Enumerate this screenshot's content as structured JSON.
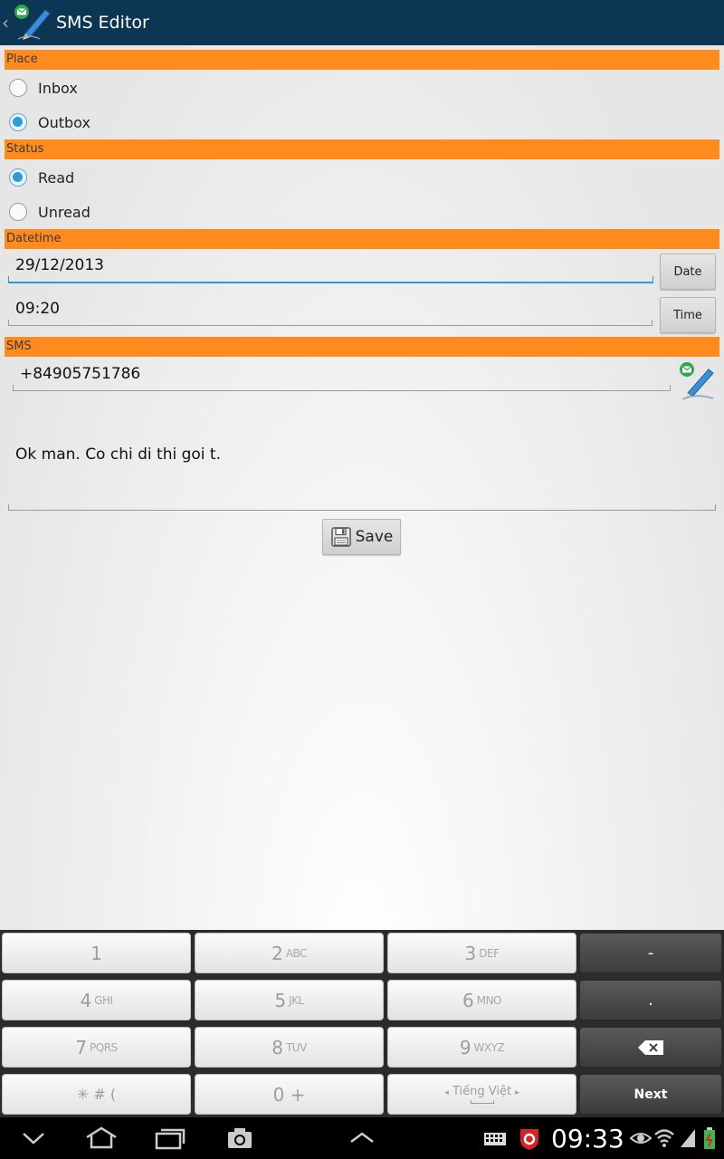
{
  "app": {
    "title": "SMS Editor"
  },
  "sections": {
    "place": "Place",
    "status": "Status",
    "datetime": "Datetime",
    "sms": "SMS"
  },
  "place_options": [
    {
      "label": "Inbox",
      "checked": false
    },
    {
      "label": "Outbox",
      "checked": true
    }
  ],
  "status_options": [
    {
      "label": "Read",
      "checked": true
    },
    {
      "label": "Unread",
      "checked": false
    }
  ],
  "datetime": {
    "date_value": "29/12/2013",
    "date_button": "Date",
    "time_value": "09:20",
    "time_button": "Time"
  },
  "sms": {
    "phone": "+84905751786",
    "message": "Ok man. Co chi di thi goi t.",
    "save_label": "Save"
  },
  "keyboard": {
    "keys": [
      {
        "num": "1",
        "letters": ""
      },
      {
        "num": "2",
        "letters": "ABC"
      },
      {
        "num": "3",
        "letters": "DEF"
      },
      {
        "num": "4",
        "letters": "GHI"
      },
      {
        "num": "5",
        "letters": "JKL"
      },
      {
        "num": "6",
        "letters": "MNO"
      },
      {
        "num": "7",
        "letters": "PQRS"
      },
      {
        "num": "8",
        "letters": "TUV"
      },
      {
        "num": "9",
        "letters": "WXYZ"
      },
      {
        "num": "✳ # (",
        "letters": ""
      },
      {
        "num": "0 +",
        "letters": ""
      }
    ],
    "language": "Tiếng Việt",
    "dash": "-",
    "dot": ".",
    "next": "Next"
  },
  "system": {
    "clock": "09:33"
  }
}
